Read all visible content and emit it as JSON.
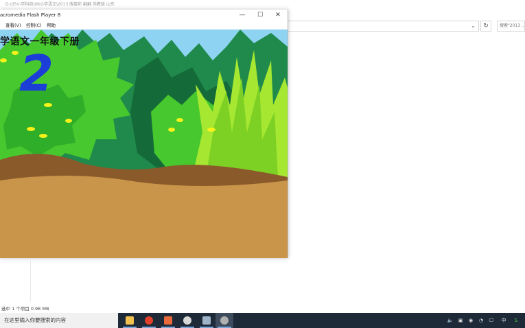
{
  "explorer": {
    "title_path": "G:\\05小学科目\\06小学语文\\2013  版鼓彩 翻翻  苏教版  山东",
    "search_placeholder": "搜索\"2013 ...",
    "status_text": "选中 1 个项目  0.98 MB",
    "refresh_glyph": "↻",
    "chevron_glyph": "⌄"
  },
  "flash_window": {
    "title": "acromedia Flash Player 8",
    "minimize": "—",
    "maximize": "☐",
    "close": "✕",
    "menu": [
      "",
      "查看(V)",
      "控制(C)",
      "帮助"
    ],
    "stage": {
      "heading": "学语文一年级下册",
      "numeral": "2",
      "colors": {
        "sky": "#8fd3f2",
        "ground": "#c8954a",
        "dark_bush": "#1f8a4b",
        "bright_bush": "#46c82e",
        "lime_grass": "#a6e831",
        "numeral": "#1b3fd6",
        "dots": "#f6f21a"
      }
    }
  },
  "taskbar": {
    "search_placeholder": "在这里输入你要搜索的内容",
    "apps": [
      {
        "name": "file-explorer-icon",
        "color": "#f2c14e"
      },
      {
        "name": "wps-red-icon",
        "color": "#e2402a"
      },
      {
        "name": "powerpoint-icon",
        "color": "#e86a3a"
      },
      {
        "name": "cloud-icon",
        "color": "#d9d9d9"
      },
      {
        "name": "app-icon",
        "color": "#9fb3c8"
      },
      {
        "name": "flash-player-icon",
        "color": "#b0b0b0"
      }
    ],
    "tray": {
      "items": [
        "🔈",
        "▣",
        "◉",
        "◔",
        "☐",
        "中",
        "S"
      ]
    }
  }
}
